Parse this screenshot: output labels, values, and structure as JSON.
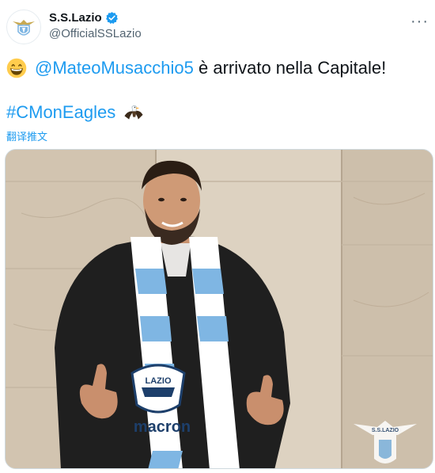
{
  "account": {
    "display_name": "S.S.Lazio",
    "handle": "@OfficialSSLazio",
    "avatar_icon": "lazio-eagle-crest-icon",
    "verified_icon": "verified-badge-icon"
  },
  "tweet": {
    "emoji_icon": "grinning-face-emoji-icon",
    "mention": "@MateoMusacchio5",
    "text_after_mention": " è arrivato nella Capitale!",
    "hashtag": "#CMonEagles",
    "hashtag_emoji_icon": "eagle-emoji-icon",
    "translate_label": "翻译推文"
  },
  "media": {
    "subject": "player-with-lazio-scarf-photo",
    "watermark_text": "S.S.LAZIO",
    "scarf_badge_text": "LAZIO",
    "scarf_sponsor_text": "macron"
  },
  "colors": {
    "link": "#1d9bf0",
    "scarf_blue": "#7fb6e3",
    "text": "#0f1419",
    "secondary": "#536471"
  }
}
